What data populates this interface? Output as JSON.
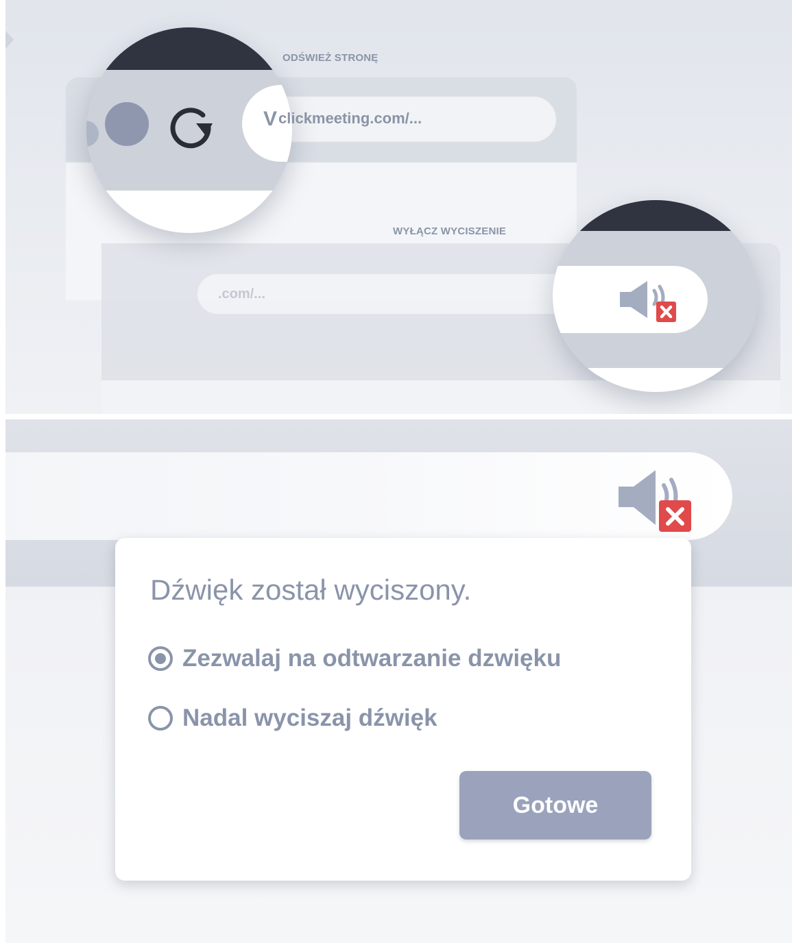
{
  "top_panel": {
    "refresh_caption": "ODŚWIEŻ STRONĘ",
    "url_text": "clickmeeting.com/...",
    "unmute_caption": "WYŁĄCZ WYCISZENIE",
    "faded_url_text": ".com/...",
    "icons": [
      "refresh-icon",
      "muted-speaker-icon"
    ]
  },
  "bottom_panel": {
    "dialog": {
      "title": "Dźwięk został wyciszony.",
      "options": [
        {
          "label": "Zezwalaj na odtwarzanie dzwięku",
          "selected": true
        },
        {
          "label": "Nadal wyciszaj dźwięk",
          "selected": false
        }
      ],
      "done_label": "Gotowe"
    }
  },
  "colors": {
    "accent_text": "#8a94a9",
    "button_bg": "#9aa3bb",
    "mute_badge": "#e04a4a",
    "speaker": "#a4acc0",
    "dark_band": "#2f3440"
  }
}
